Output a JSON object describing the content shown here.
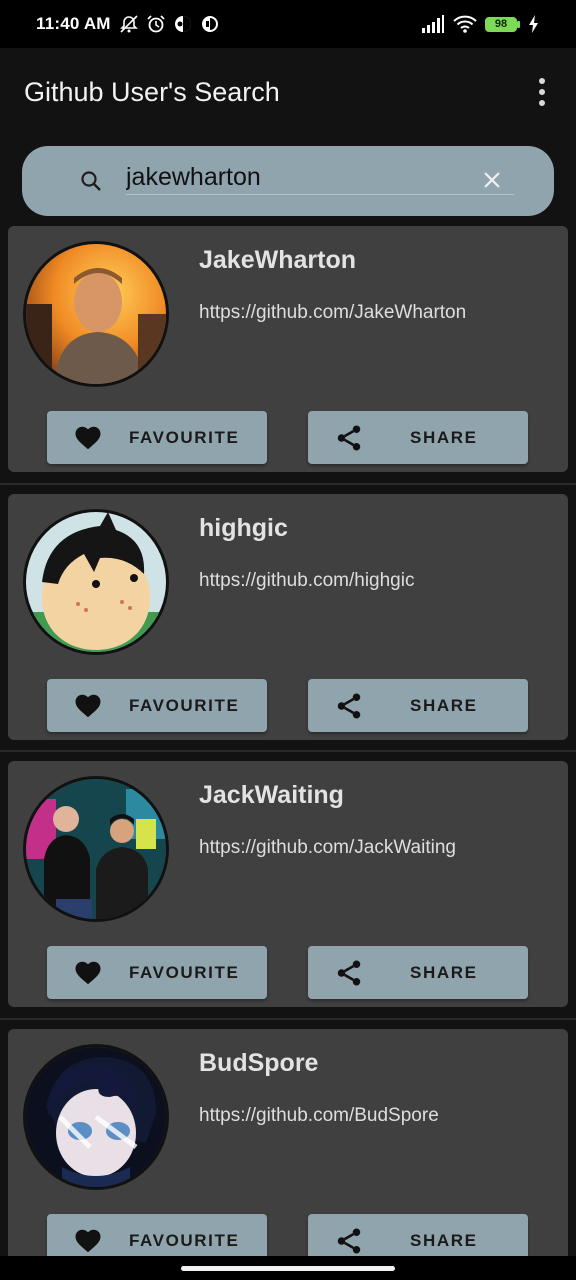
{
  "status_bar": {
    "time": "11:40 AM",
    "battery": "98",
    "icons_left": [
      "mute-alarm-icon",
      "alarm-icon",
      "app-icon",
      "app-icon"
    ],
    "icons_right": [
      "signal-icon",
      "wifi-icon",
      "battery-icon",
      "charging-icon"
    ]
  },
  "app_bar": {
    "title": "Github User's Search",
    "menu_icon": "overflow-menu-icon"
  },
  "search": {
    "value": "jakewharton",
    "icon": "search-icon",
    "clear_icon": "close-icon"
  },
  "users": [
    {
      "username": "JakeWharton",
      "url": "https://github.com/JakeWharton",
      "favourite_label": "FAVOURITE",
      "share_label": "SHARE"
    },
    {
      "username": "highgic",
      "url": "https://github.com/highgic",
      "favourite_label": "FAVOURITE",
      "share_label": "SHARE"
    },
    {
      "username": "JackWaiting",
      "url": "https://github.com/JackWaiting",
      "favourite_label": "FAVOURITE",
      "share_label": "SHARE"
    },
    {
      "username": "BudSpore",
      "url": "https://github.com/BudSpore",
      "favourite_label": "FAVOURITE",
      "share_label": "SHARE"
    }
  ],
  "colors": {
    "background": "#121212",
    "card": "#404040",
    "accent": "#90a4ae",
    "battery": "#7ed957"
  }
}
